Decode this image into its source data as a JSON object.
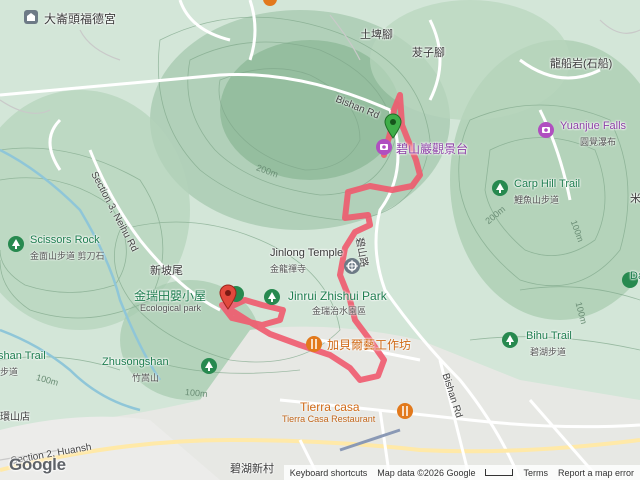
{
  "places": {
    "temple_top": "大崙頭福德宮",
    "tutuo": "土埤腳",
    "bazi": "茇子腳",
    "longchuan": "龍船岩(石船)",
    "bishan_road_top": "Bishan Rd",
    "bishan_road_bottom": "Bishan Rd",
    "bishan_road_zh": "碧山路",
    "scenic": "碧山巖觀景台",
    "yuanjue_en": "Yuanjue Falls",
    "yuanjue_zh": "圓覺瀑布",
    "carp_en": "Carp Hill Trail",
    "carp_zh": "鯉魚山步道",
    "jinlong_en": "Jinlong Temple",
    "jinlong_zh": "金龍禪寺",
    "scissors_en": "Scissors Rock",
    "scissors_zh": "金面山步道 剪刀石",
    "neihu_road": "Section 3, Neihu Rd",
    "xinpo": "新坡尾",
    "eco_zh": "金瑞田嬰小屋",
    "eco_en": "Ecological park",
    "jinrui_en": "Jinrui Zhishui Park",
    "jinrui_zh": "金瑞治水園區",
    "bihu_en": "Bihu Trail",
    "bihu_zh": "碧湖步道",
    "jiabei": "加貝爾藝工作坊",
    "shan_trail_en": "shan Trail",
    "shan_trail_zh": "步道",
    "zhusong_en": "Zhusongshan",
    "zhusong_zh": "竹嵩山",
    "tierra_top": "Tierra casa",
    "tierra_bottom": "Tierra Casa Restaurant",
    "huanshan": "環山店",
    "section2": "Section 2, Huansh",
    "bihu_village": "碧湖新村",
    "da_en": "Da",
    "mi": "米",
    "contour_200_a": "200m",
    "contour_200_b": "200m",
    "contour_100_a": "100m",
    "contour_100_b": "100m",
    "contour_100_c": "100m",
    "contour_100_d": "100m"
  },
  "attribution": {
    "logo": "Google",
    "shortcuts": "Keyboard shortcuts",
    "mapdata": "Map data ©2026 Google",
    "terms": "Terms",
    "report": "Report a map error"
  },
  "colors": {
    "route": "#f05a6e",
    "poi_green": "#27894f",
    "poi_purple": "#b04fc0",
    "poi_orange": "#e2791c",
    "start_marker": "#e2493d",
    "end_marker": "#3fae49"
  }
}
